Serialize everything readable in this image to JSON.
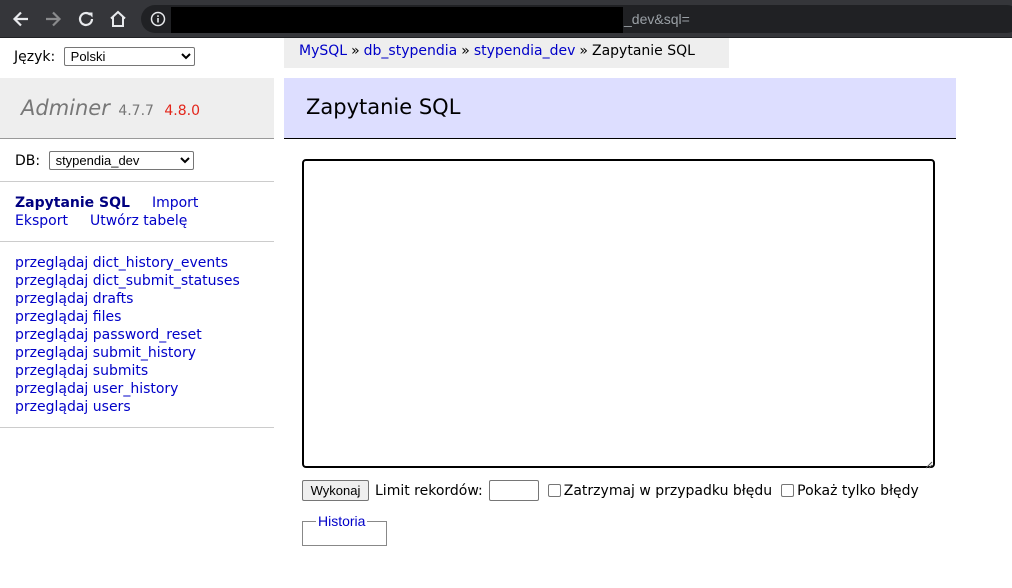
{
  "browser": {
    "url_visible": "_dev&sql="
  },
  "language": {
    "label": "Język:",
    "selected": "Polski"
  },
  "logo": {
    "name": "Adminer",
    "version": "4.7.7",
    "new_version": "4.8.0"
  },
  "db": {
    "label": "DB:",
    "selected": "stypendia_dev"
  },
  "sidebar_links": {
    "sql": "Zapytanie SQL",
    "import": "Import",
    "export": "Eksport",
    "create_table": "Utwórz tabelę"
  },
  "tables": [
    {
      "action": "przeglądaj",
      "name": "dict_history_events"
    },
    {
      "action": "przeglądaj",
      "name": "dict_submit_statuses"
    },
    {
      "action": "przeglądaj",
      "name": "drafts"
    },
    {
      "action": "przeglądaj",
      "name": "files"
    },
    {
      "action": "przeglądaj",
      "name": "password_reset"
    },
    {
      "action": "przeglądaj",
      "name": "submit_history"
    },
    {
      "action": "przeglądaj",
      "name": "submits"
    },
    {
      "action": "przeglądaj",
      "name": "user_history"
    },
    {
      "action": "przeglądaj",
      "name": "users"
    }
  ],
  "breadcrumb": {
    "items": [
      "MySQL",
      "db_stypendia",
      "stypendia_dev"
    ],
    "separator": "»",
    "current": "Zapytanie SQL"
  },
  "page": {
    "title": "Zapytanie SQL"
  },
  "form": {
    "sql_value": "",
    "execute_label": "Wykonaj",
    "limit_label": "Limit rekordów:",
    "limit_value": "",
    "stop_on_error_label": "Zatrzymaj w przypadku błędu",
    "only_errors_label": "Pokaż tylko błędy",
    "history_label": "Historia"
  },
  "colors": {
    "link": "#0000c8",
    "heading_bg": "#dddeff",
    "new_version": "#e3261b"
  }
}
